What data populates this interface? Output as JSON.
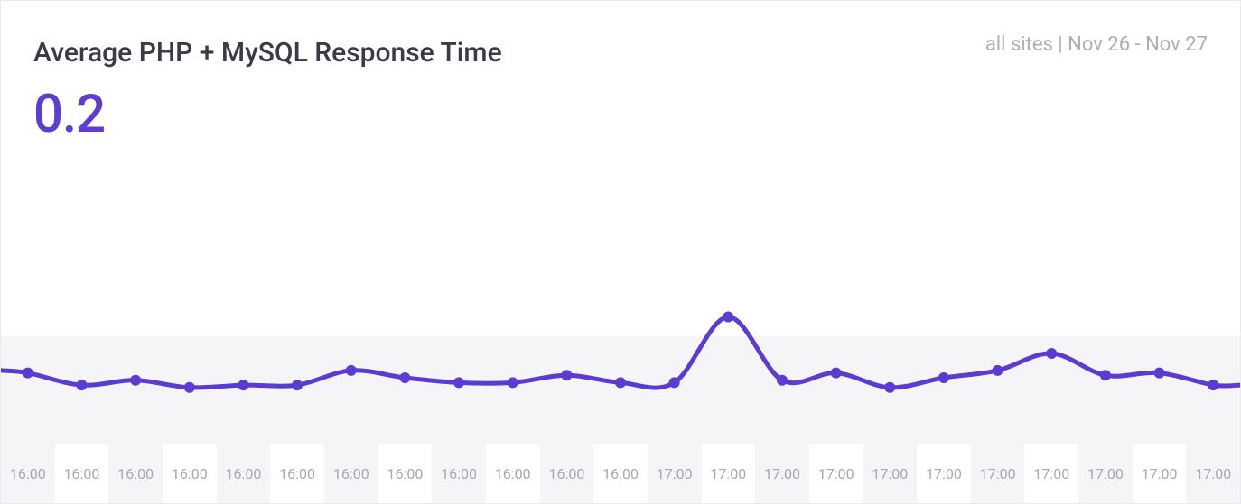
{
  "header": {
    "title": "Average PHP + MySQL Response Time",
    "meta": "all sites | Nov 26 - Nov 27"
  },
  "value": "0.2",
  "colors": {
    "line": "#5b3bd1",
    "marker": "#5b3bd1"
  },
  "chart_data": {
    "type": "line",
    "title": "Average PHP + MySQL Response Time",
    "xlabel": "",
    "ylabel": "",
    "ylim": [
      0,
      1.0
    ],
    "categories": [
      "16:00",
      "16:00",
      "16:00",
      "16:00",
      "16:00",
      "16:00",
      "16:00",
      "16:00",
      "16:00",
      "16:00",
      "16:00",
      "16:00",
      "17:00",
      "17:00",
      "17:00",
      "17:00",
      "17:00",
      "17:00",
      "17:00",
      "17:00",
      "17:00",
      "17:00",
      "17:00"
    ],
    "values": [
      0.22,
      0.17,
      0.19,
      0.16,
      0.17,
      0.17,
      0.23,
      0.2,
      0.18,
      0.18,
      0.21,
      0.18,
      0.18,
      0.45,
      0.19,
      0.22,
      0.16,
      0.2,
      0.23,
      0.3,
      0.21,
      0.22,
      0.17
    ]
  }
}
